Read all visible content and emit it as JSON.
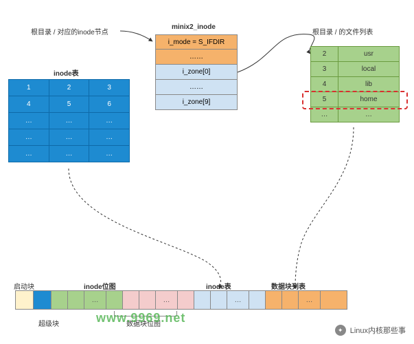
{
  "labels": {
    "root_inode_annot": "根目录 / 对应的inode节点",
    "minix_title": "minix2_inode",
    "root_filelist_annot": "根目录 / 的文件列表",
    "inode_table_title": "inode表"
  },
  "minix_rows": {
    "r0": "i_mode = S_IFDIR",
    "r1": "……",
    "r2": "i_zone[0]",
    "r3": "……",
    "r4": "i_zone[9]"
  },
  "inode_grid": {
    "r0c0": "1",
    "r0c1": "2",
    "r0c2": "3",
    "r1c0": "4",
    "r1c1": "5",
    "r1c2": "6",
    "r2c0": "…",
    "r2c1": "…",
    "r2c2": "…",
    "r3c0": "…",
    "r3c1": "…",
    "r3c2": "…",
    "r4c0": "…",
    "r4c1": "…",
    "r4c2": "…"
  },
  "dir_entries": {
    "r0n": "2",
    "r0v": "usr",
    "r1n": "3",
    "r1v": "local",
    "r2n": "4",
    "r2v": "lib",
    "r3n": "5",
    "r3v": "home",
    "r4n": "…",
    "r4v": "…"
  },
  "disk": {
    "boot_label": "启动块",
    "super_label": "超级块",
    "inode_bitmap_label": "inode位图",
    "data_bitmap_label": "数据块位图",
    "inode_table_label": "inode表",
    "data_blocks_label": "数据块列表",
    "ellipsis": "…"
  },
  "watermark": "www.9969.net",
  "footer": {
    "brand": "Linux内核那些事"
  }
}
